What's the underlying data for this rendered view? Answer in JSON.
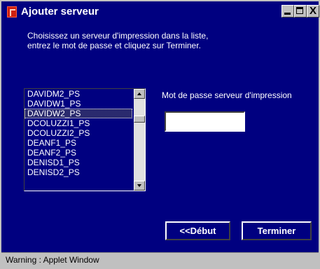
{
  "window": {
    "title": "Ajouter serveur",
    "controls": {
      "minimize": "_",
      "maximize": "□",
      "close": "X"
    }
  },
  "instructions": {
    "line1": "Choisissez un serveur d'impression dans la liste,",
    "line2": "entrez le mot de passe et cliquez sur Terminer."
  },
  "server_list": {
    "items": [
      "DAVIDM2_PS",
      "DAVIDW1_PS",
      "DAVIDW2_PS",
      "DCOLUZZI1_PS",
      "DCOLUZZI2_PS",
      "DEANF1_PS",
      "DEANF2_PS",
      "DENISD1_PS",
      "DENISD2_PS"
    ],
    "selected": "DAVIDW2_PS"
  },
  "password": {
    "label": "Mot de passe serveur d'impression",
    "value": ""
  },
  "buttons": {
    "debut": "<<Début",
    "terminer": "Terminer"
  },
  "status": {
    "text": "Warning : Applet Window"
  },
  "colors": {
    "background": "#000080",
    "chrome": "#c0c0c0",
    "text": "#ffffff"
  }
}
